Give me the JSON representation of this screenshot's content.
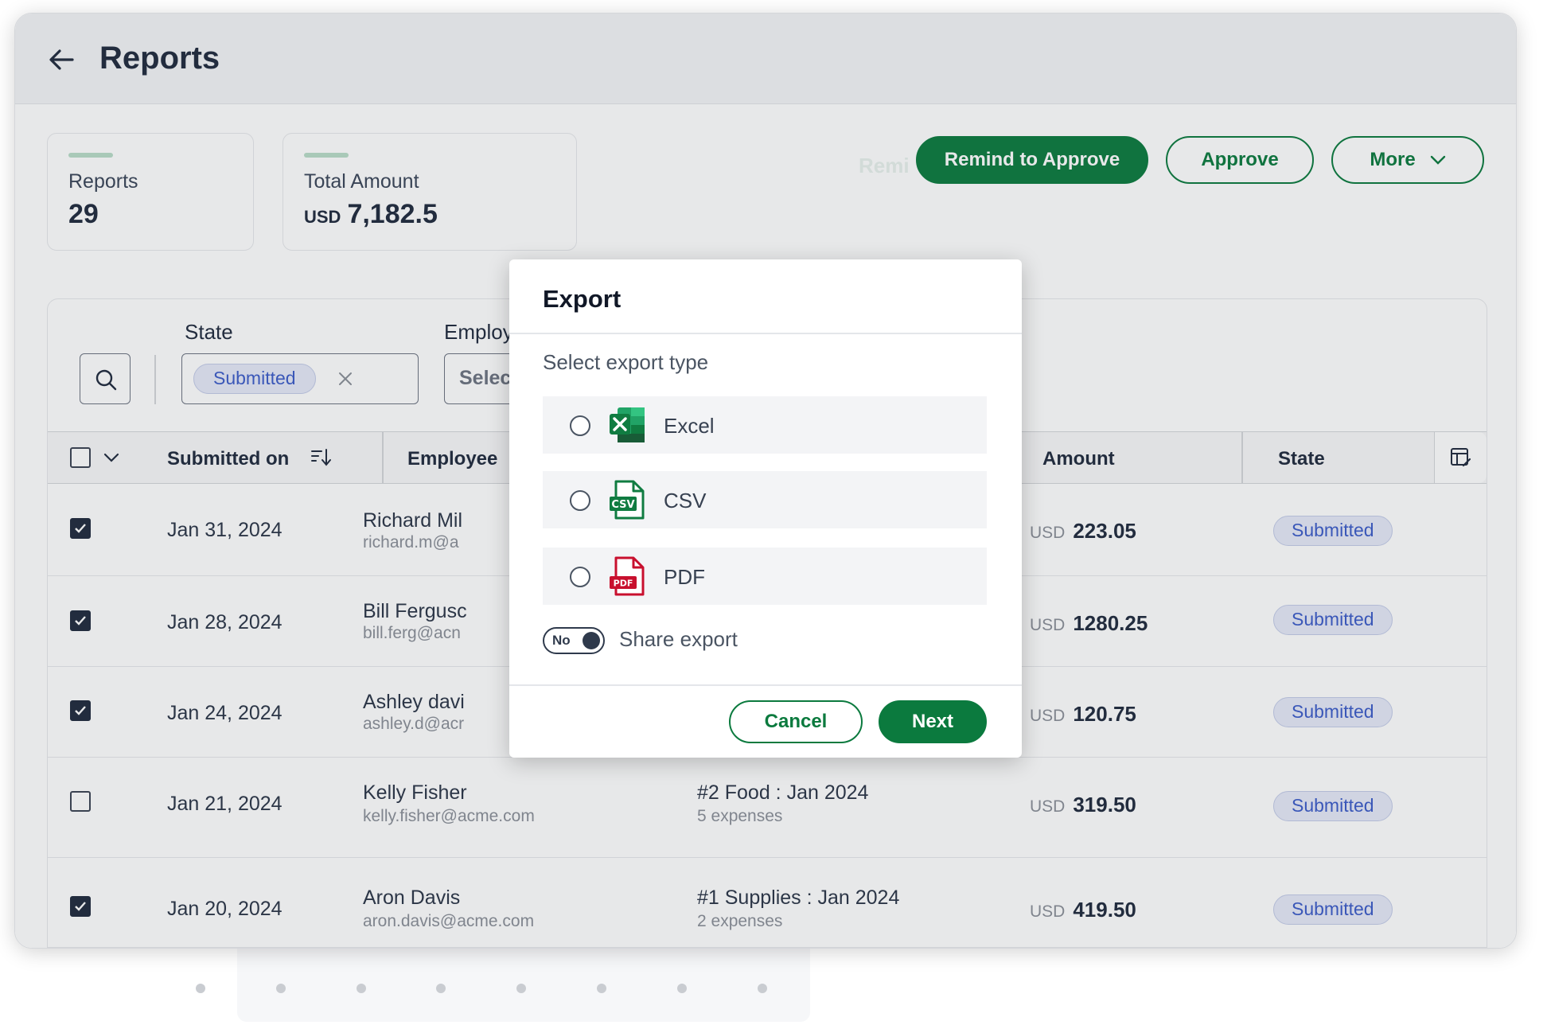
{
  "header": {
    "title": "Reports"
  },
  "stats": [
    {
      "label": "Reports",
      "value": "29",
      "unit": ""
    },
    {
      "label": "Total Amount",
      "value": "7,182.5",
      "unit": "USD"
    }
  ],
  "toolbar": {
    "faint_label": "Remi",
    "remind_label": "Remind to Approve",
    "approve_label": "Approve",
    "more_label": "More"
  },
  "filters": {
    "state_label": "State",
    "state_chip": "Submitted",
    "employee_label": "Employ",
    "employee_placeholder": "Selec"
  },
  "table": {
    "columns": {
      "submitted_on": "Submitted on",
      "employee": "Employee",
      "amount": "Amount",
      "state": "State"
    },
    "rows": [
      {
        "checked": true,
        "date": "Jan 31, 2024",
        "name": "Richard Mil",
        "email": "richard.m@a",
        "report": "",
        "expenses": "",
        "currency": "USD",
        "amount": "223.05",
        "state": "Submitted"
      },
      {
        "checked": true,
        "date": "Jan 28, 2024",
        "name": "Bill Fergusc",
        "email": "bill.ferg@acn",
        "report": "",
        "expenses": "",
        "currency": "USD",
        "amount": "1280.25",
        "state": "Submitted"
      },
      {
        "checked": true,
        "date": "Jan 24, 2024",
        "name": "Ashley davi",
        "email": "ashley.d@acr",
        "report": "",
        "expenses": "",
        "currency": "USD",
        "amount": "120.75",
        "state": "Submitted"
      },
      {
        "checked": false,
        "date": "Jan 21, 2024",
        "name": "Kelly Fisher",
        "email": "kelly.fisher@acme.com",
        "report": "#2 Food : Jan 2024",
        "expenses": "5 expenses",
        "currency": "USD",
        "amount": "319.50",
        "state": "Submitted"
      },
      {
        "checked": true,
        "date": "Jan 20, 2024",
        "name": "Aron Davis",
        "email": "aron.davis@acme.com",
        "report": "#1 Supplies : Jan 2024",
        "expenses": "2 expenses",
        "currency": "USD",
        "amount": "419.50",
        "state": "Submitted"
      }
    ]
  },
  "modal": {
    "title": "Export",
    "subtitle": "Select export type",
    "options": [
      {
        "label": "Excel",
        "icon": "excel-icon"
      },
      {
        "label": "CSV",
        "icon": "csv-icon"
      },
      {
        "label": "PDF",
        "icon": "pdf-icon"
      }
    ],
    "toggle_text": "No",
    "share_label": "Share export",
    "cancel_label": "Cancel",
    "next_label": "Next"
  },
  "colors": {
    "brand": "#0b7a3e",
    "badge_bg": "#e5e9f8",
    "badge_text": "#3b5bc8",
    "pdf_red": "#c8102e"
  }
}
